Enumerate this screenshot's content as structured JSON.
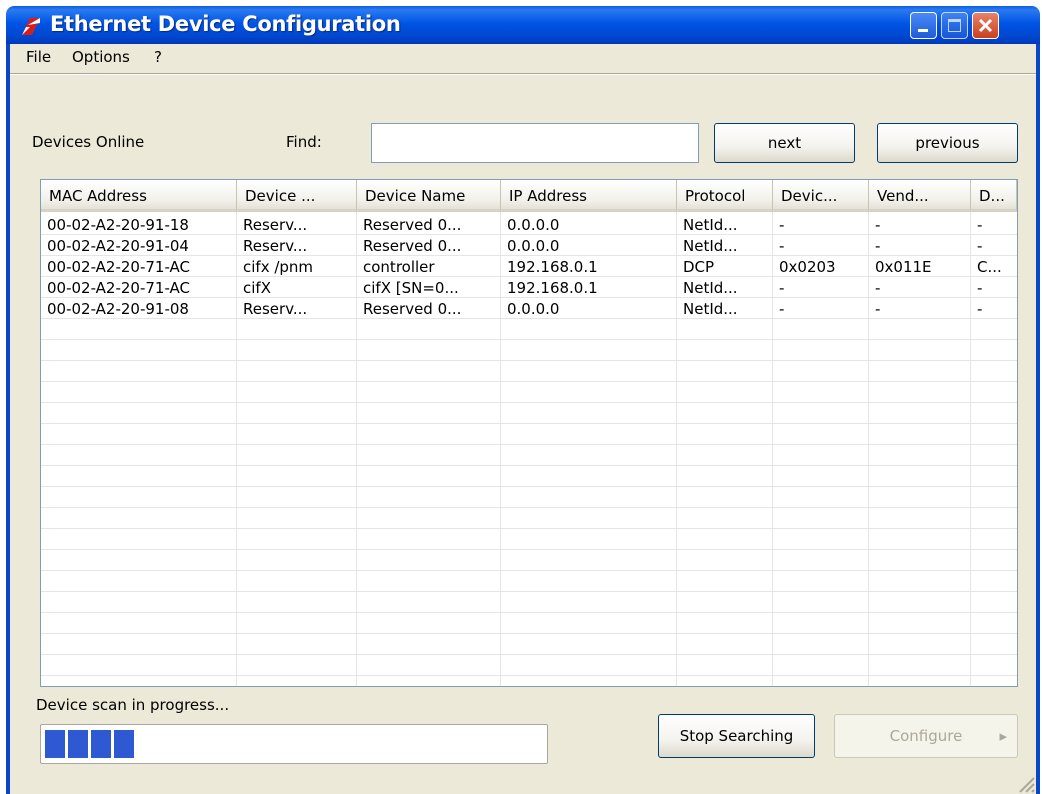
{
  "window": {
    "title": "Ethernet Device Configuration"
  },
  "menu": {
    "file": "File",
    "options": "Options",
    "help": "?"
  },
  "top": {
    "devices_online": "Devices Online",
    "find_label": "Find:",
    "find_value": "",
    "next": "next",
    "previous": "previous"
  },
  "table": {
    "columns": [
      "MAC Address",
      "Device ...",
      "Device Name",
      "IP Address",
      "Protocol",
      "Devic...",
      "Vend...",
      "D..."
    ],
    "rows": [
      [
        "00-02-A2-20-91-18",
        "Reserv...",
        "Reserved 0...",
        "0.0.0.0",
        "NetId...",
        "-",
        "-",
        "-"
      ],
      [
        "00-02-A2-20-91-04",
        "Reserv...",
        "Reserved 0...",
        "0.0.0.0",
        "NetId...",
        "-",
        "-",
        "-"
      ],
      [
        "00-02-A2-20-71-AC",
        "cifx /pnm",
        "controller",
        "192.168.0.1",
        "DCP",
        "0x0203",
        "0x011E",
        "C..."
      ],
      [
        "00-02-A2-20-71-AC",
        "cifX",
        "cifX [SN=0...",
        "192.168.0.1",
        "NetId...",
        "-",
        "-",
        "-"
      ],
      [
        "00-02-A2-20-91-08",
        "Reserv...",
        "Reserved 0...",
        "0.0.0.0",
        "NetId...",
        "-",
        "-",
        "-"
      ]
    ]
  },
  "status": {
    "text": "Device scan in progress...",
    "progress_blocks": 4
  },
  "buttons": {
    "stop": "Stop Searching",
    "configure": "Configure"
  },
  "colors": {
    "title_bar": "#0055e5",
    "progress": "#2f59d3",
    "window_bg": "#ece9d8"
  }
}
